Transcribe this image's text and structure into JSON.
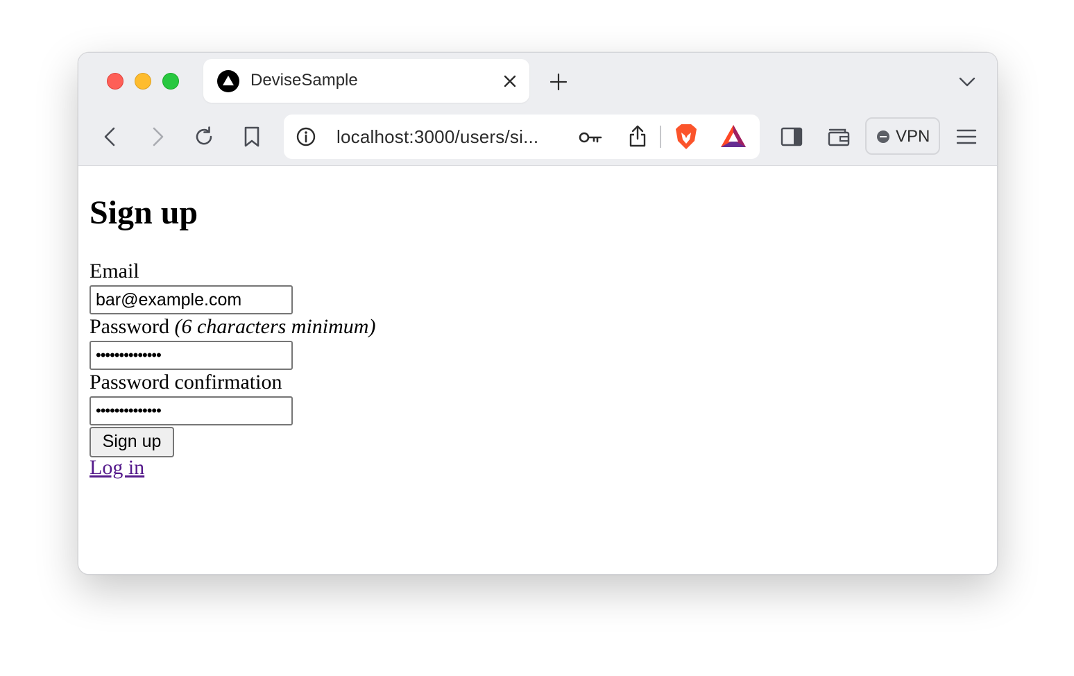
{
  "browser": {
    "tab": {
      "title": "DeviseSample",
      "favicon": "triangle-logo-icon"
    },
    "address_bar": {
      "url": "localhost:3000/users/si..."
    },
    "vpn_label": "VPN",
    "icons": [
      "close-tab-icon",
      "new-tab-icon",
      "tab-list-chevron-icon",
      "back-icon",
      "forward-icon",
      "reload-icon",
      "bookmark-icon",
      "site-info-icon",
      "password-key-icon",
      "share-icon",
      "brave-shields-icon",
      "brave-rewards-icon",
      "sidebar-icon",
      "wallet-icon",
      "menu-icon"
    ]
  },
  "page": {
    "heading": "Sign up",
    "email": {
      "label": "Email",
      "value": "bar@example.com"
    },
    "password": {
      "label": "Password",
      "hint": "(6 characters minimum)",
      "masked_value": "••••••••••••••"
    },
    "password_confirmation": {
      "label": "Password confirmation",
      "masked_value": "••••••••••••••"
    },
    "submit_label": "Sign up",
    "login_link": "Log in"
  },
  "colors": {
    "chrome_bg": "#edeef1",
    "link_visited": "#551a8b",
    "traffic_red": "#fe5f57",
    "traffic_yellow": "#febc2e",
    "traffic_green": "#28c840"
  }
}
